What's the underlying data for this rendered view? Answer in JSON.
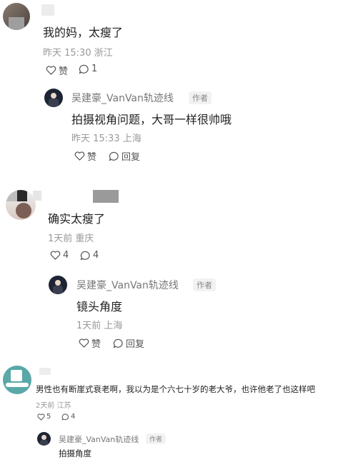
{
  "comments": [
    {
      "text": "我的妈，太瘦了",
      "time": "昨天 15:30",
      "location": "浙江",
      "likes": "赞",
      "replies": "1",
      "reply": {
        "author": "吴建豪_VanVan轨迹线",
        "badge": "作者",
        "text": "拍摄视角问题，大哥一样很帅哦",
        "time": "昨天 15:33",
        "location": "上海",
        "likes": "赞",
        "reply_label": "回复"
      }
    },
    {
      "text": "确实太瘦了",
      "time": "1天前",
      "location": "重庆",
      "likes": "4",
      "replies": "4",
      "reply": {
        "author": "吴建豪_VanVan轨迹线",
        "badge": "作者",
        "text": "镜头角度",
        "time": "1天前",
        "location": "上海",
        "likes": "赞",
        "reply_label": "回复"
      }
    },
    {
      "text": "男性也有断崖式衰老啊，我以为是个六七十岁的老大爷，也许他老了也这样吧",
      "time": "2天前",
      "location": "江苏",
      "likes": "5",
      "replies": "4",
      "reply": {
        "author": "吴建豪_VanVan轨迹线",
        "badge": "作者",
        "text": "拍摄角度"
      }
    }
  ],
  "colors": {
    "meta": "#999999",
    "badge_bg": "#f2f2f2",
    "text": "#222222"
  }
}
